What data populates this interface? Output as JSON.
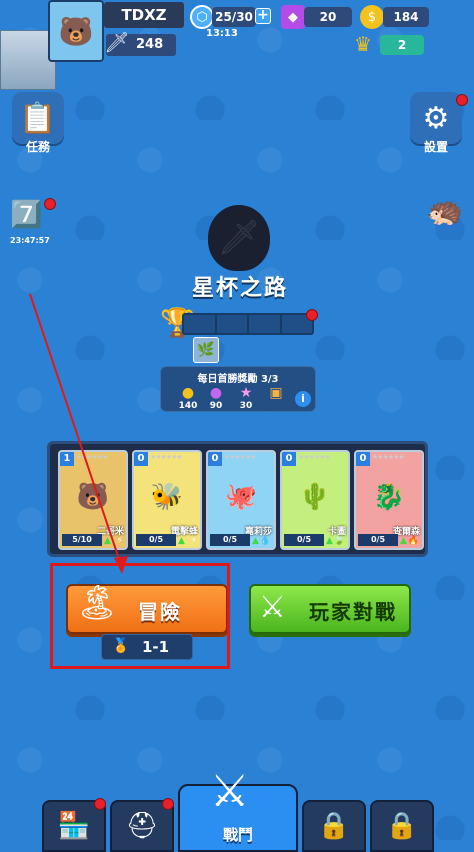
{
  "player": {
    "name": "TDXZ",
    "power": "248"
  },
  "resources": {
    "energy": "25/30",
    "energy_timer": "13:13",
    "gems": "20",
    "coins": "184",
    "crowns": "2"
  },
  "side": {
    "tasks_label": "任務",
    "settings_label": "設置",
    "event_timer": "23:47:57"
  },
  "trophy_road": {
    "title": "星杯之路",
    "daily_title": "每日首勝獎勵 3/3",
    "rewards": [
      {
        "icon": "coin-icon",
        "value": "140"
      },
      {
        "icon": "gem-icon",
        "value": "90"
      },
      {
        "icon": "star-icon",
        "value": "30"
      },
      {
        "icon": "chest-icon",
        "value": ""
      }
    ]
  },
  "deck": [
    {
      "level": "1",
      "name": "二哥米",
      "count": "5/10",
      "element": "lightning",
      "bg": "#e9c36a",
      "art": "🐻"
    },
    {
      "level": "0",
      "name": "電擊蜂",
      "count": "0/5",
      "element": "lightning",
      "bg": "#f3e37a",
      "art": "🐝"
    },
    {
      "level": "0",
      "name": "嘉莉莎",
      "count": "0/5",
      "element": "water",
      "bg": "#8fd3f5",
      "art": "🐙"
    },
    {
      "level": "0",
      "name": "卡圖",
      "count": "0/5",
      "element": "grass",
      "bg": "#c4ee7e",
      "art": "🌵"
    },
    {
      "level": "0",
      "name": "查爾森",
      "count": "0/5",
      "element": "fire",
      "bg": "#f2a2a0",
      "art": "🐉"
    }
  ],
  "buttons": {
    "adventure_label": "冒險",
    "stage": "1-1",
    "pvp_label": "玩家對戰"
  },
  "nav": {
    "battle_label": "戰鬥"
  },
  "colors": {
    "background": "#2b82d4",
    "adventure": "#f07116",
    "pvp": "#4ab51e",
    "highlight": "#e01a1a"
  }
}
